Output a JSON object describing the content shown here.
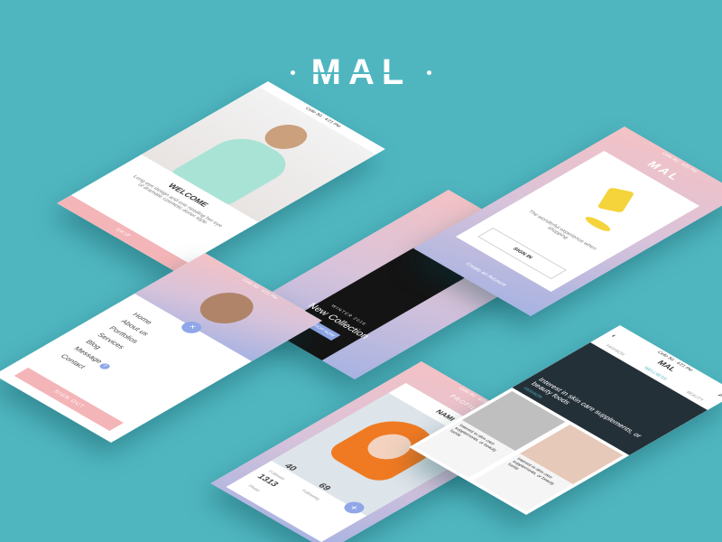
{
  "brand": {
    "logo": "MAL"
  },
  "status_bar": {
    "carrier": "Cello 3G",
    "time": "4:21 PM"
  },
  "welcome_screen": {
    "title": "WELCOME",
    "body": "Long eye design and one needing her eye of dramatic cosmetic donor style.",
    "skip_label": "SKIP"
  },
  "collection_screen": {
    "logo": "MAL",
    "season": "WINTER 2016",
    "title": "New Collection",
    "button_label": "SHOP NOW"
  },
  "signin_screen": {
    "logo": "MAL",
    "tagline": "The wonderful experience when shopping",
    "button_label": "SIGN IN",
    "create_account_label": "Create an Account"
  },
  "menu_screen": {
    "items": [
      "Home",
      "About us",
      "Portfolios",
      "Services",
      "Blog",
      "Message",
      "Contact"
    ],
    "message_badge": "2",
    "button_label": "SIGN OUT"
  },
  "profile_screen": {
    "header": "PROFILE",
    "name": "NAMI",
    "stats": [
      {
        "value": "40",
        "label": "Follower"
      },
      {
        "value": "69",
        "label": "Following"
      },
      {
        "value": "1313",
        "label": "Photo"
      }
    ]
  },
  "feed_screen": {
    "logo": "MAL",
    "tabs": [
      "FASHION",
      "WELLNESS",
      "BEAUTY"
    ],
    "headline": "Interest in skin care supplements, or beauty foods",
    "category": "FASHION",
    "card_text_1": "Interest in skin care supplements, or beauty foods",
    "card_text_2": "Interest in skin care supplements, or beauty foods"
  },
  "colors": {
    "background": "#4fb6c0",
    "pink": "#f4c2c5",
    "lavender": "#a7b3e2",
    "accent": "#f4b5b8"
  }
}
